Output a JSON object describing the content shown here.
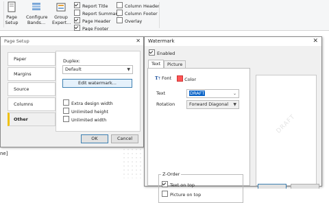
{
  "ribbon": {
    "page_setup": "Page\nSetup",
    "configure_bands": "Configure\nBands...",
    "group_expert": "Group\nExpert...",
    "checks_col1": [
      {
        "label": "Report Title",
        "checked": true
      },
      {
        "label": "Report Summary",
        "checked": false
      },
      {
        "label": "Page Header",
        "checked": true
      },
      {
        "label": "Page Footer",
        "checked": true
      }
    ],
    "checks_col2": [
      {
        "label": "Column Header",
        "checked": false
      },
      {
        "label": "Column Footer",
        "checked": false
      },
      {
        "label": "Overlay",
        "checked": false
      }
    ]
  },
  "designer": {
    "fragment_text": "ne]"
  },
  "page_setup": {
    "title": "Page Setup",
    "tabs": [
      "Paper",
      "Margins",
      "Source",
      "Columns",
      "Other"
    ],
    "selected_tab": "Other",
    "duplex_label": "Duplex:",
    "duplex_value": "Default",
    "edit_watermark": "Edit watermark...",
    "options": [
      {
        "label": "Extra design width",
        "checked": false
      },
      {
        "label": "Unlimited height",
        "checked": false
      },
      {
        "label": "Unlimited width",
        "checked": false
      }
    ],
    "ok": "OK",
    "cancel": "Cancel"
  },
  "watermark": {
    "title": "Watermark",
    "enabled_label": "Enabled",
    "enabled": true,
    "tabs": [
      "Text",
      "Picture"
    ],
    "selected_tab": "Text",
    "font_label": "Font",
    "color_label": "Color",
    "text_label": "Text",
    "text_value": "DRAFT",
    "rotation_label": "Rotation",
    "rotation_value": "Forward Diagonal",
    "zorder_label": "Z-Order",
    "text_on_top": "Text on top",
    "text_on_top_checked": true,
    "picture_on_top": "Picture on top",
    "picture_on_top_checked": false,
    "preview_text": "DRAFT"
  }
}
